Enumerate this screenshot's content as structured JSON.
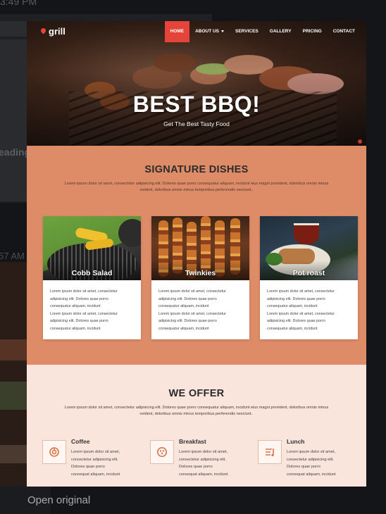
{
  "background": {
    "time_top": "3:49 PM",
    "time_mid": "57 AM",
    "heading_fragment": "eading"
  },
  "open_original_label": "Open original",
  "site": {
    "logo": "grill",
    "menu": [
      {
        "label": "HOME",
        "active": true
      },
      {
        "label": "ABOUT US",
        "active": false,
        "dropdown": true
      },
      {
        "label": "SERVICES",
        "active": false
      },
      {
        "label": "GALLERY",
        "active": false
      },
      {
        "label": "PRICING",
        "active": false
      },
      {
        "label": "CONTACT",
        "active": false
      }
    ],
    "hero": {
      "title": "BEST BBQ!",
      "subtitle": "Get The Best Tasty Food"
    },
    "signature": {
      "title": "SIGNATURE DISHES",
      "description": "Lorem ipsum dolor sit amet, consectetur adipisicing elit. Dolores quae porro consequatur aliquam, incidunt eius magni provident, doloribus omnis minus ovident, doloribus omnis minus temporibus perferendis nesciunt..",
      "cards": [
        {
          "name": "Cobb Salad",
          "lines": [
            "Lorem ipsum dolor sit amet, consectetur",
            "adipisicing elit. Dolores quae porro",
            "consequatur aliquam, incidunt",
            "Lorem ipsum dolor sit amet, consectetur",
            "adipisicing elit. Dolores quae porro",
            "consequatur aliquam, incidunt"
          ]
        },
        {
          "name": "Twinkies",
          "lines": [
            "Lorem ipsum dolor sit amet, consectetur",
            "adipisicing elit. Dolores quae porro",
            "consequatur aliquam, incidunt",
            "Lorem ipsum dolor sit amet, consectetur",
            "adipisicing elit. Dolores quae porro",
            "consequatur aliquam, incidunt"
          ]
        },
        {
          "name": "Pot roast",
          "lines": [
            "Lorem ipsum dolor sit amet, consectetur",
            "adipisicing elit. Dolores quae porro",
            "consequatur aliquam, incidunt",
            "Lorem ipsum dolor sit amet, consectetur",
            "adipisicing elit. Dolores quae porro",
            "consequatur aliquam, incidunt"
          ]
        }
      ]
    },
    "offer": {
      "title": "WE OFFER",
      "description": "Lorem ipsum dolor sit amet, consectetur adipisicing elit. Dolores quae porro consequatur aliquam, incidunt eius magni provident, doloribus omnis minus ovident, doloribus omnis minus temporibus perferendis nesciunt..",
      "items": [
        {
          "name": "Coffee",
          "icon": "coffee-icon",
          "lines": [
            "Lorem ipsum dolor sit amet,",
            "consectetur adipisicing elit.",
            "Dolores quae porro",
            "consequat aliquam, incidunt"
          ]
        },
        {
          "name": "Breakfast",
          "icon": "breakfast-icon",
          "lines": [
            "Lorem ipsum dolor sit amet,",
            "consectetur adipisicing elit.",
            "Dolores quae porro",
            "consequat aliquam, incidunt"
          ]
        },
        {
          "name": "Lunch",
          "icon": "lunch-icon",
          "lines": [
            "Lorem ipsum dolor sit amet,",
            "consectetur adipisicing elit.",
            "Dolores quae porro",
            "consequat aliquam, incidunt"
          ]
        }
      ]
    }
  },
  "colors": {
    "accent": "#e5443b",
    "dishes_bg": "#de8c67",
    "offer_bg": "#f9e5dc",
    "icon": "#d7754a"
  }
}
